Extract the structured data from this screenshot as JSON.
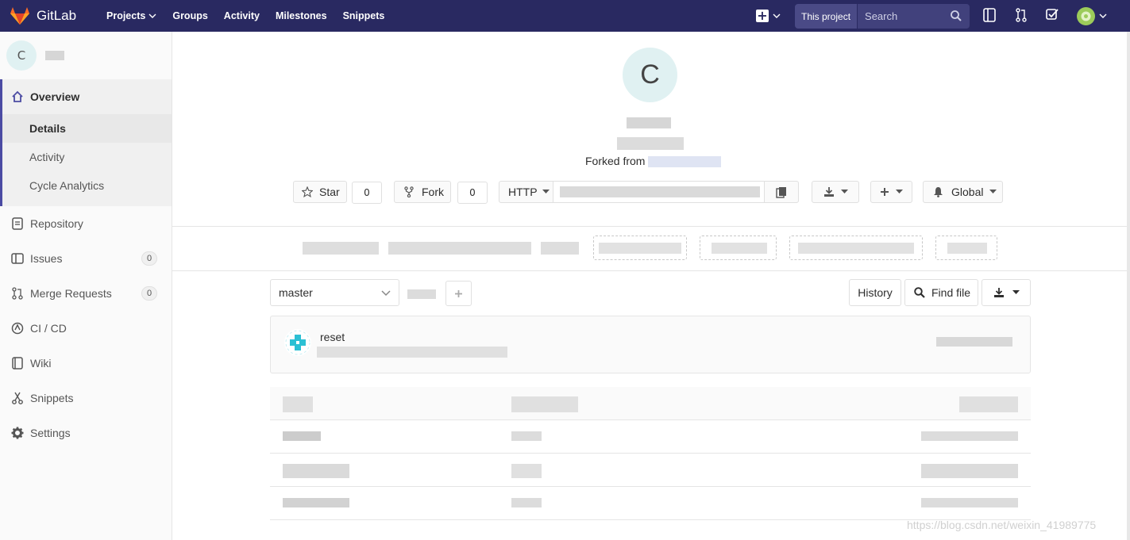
{
  "brand": {
    "name": "GitLab"
  },
  "topnav": {
    "items": [
      "Projects",
      "Groups",
      "Activity",
      "Milestones",
      "Snippets"
    ],
    "search_scope": "This project",
    "search_placeholder": "Search"
  },
  "project": {
    "avatar_letter": "C",
    "forked_from_label": "Forked from"
  },
  "sidebar": {
    "overview": "Overview",
    "overview_sub": [
      "Details",
      "Activity",
      "Cycle Analytics"
    ],
    "items": [
      {
        "label": "Repository",
        "icon": "repository-icon"
      },
      {
        "label": "Issues",
        "icon": "issues-icon",
        "badge": "0"
      },
      {
        "label": "Merge Requests",
        "icon": "merge-request-icon",
        "badge": "0"
      },
      {
        "label": "CI / CD",
        "icon": "ci-cd-icon"
      },
      {
        "label": "Wiki",
        "icon": "wiki-icon"
      },
      {
        "label": "Snippets",
        "icon": "snippets-icon"
      },
      {
        "label": "Settings",
        "icon": "settings-icon"
      }
    ]
  },
  "actions": {
    "star_label": "Star",
    "star_count": "0",
    "fork_label": "Fork",
    "fork_count": "0",
    "protocol": "HTTP",
    "notification": "Global"
  },
  "repo": {
    "branch": "master",
    "history_label": "History",
    "find_file_label": "Find file",
    "commit_title": "reset"
  },
  "watermark": "https://blog.csdn.net/weixin_41989775",
  "colors": {
    "topbar": "#292961",
    "accent": "#4b4ba3"
  }
}
